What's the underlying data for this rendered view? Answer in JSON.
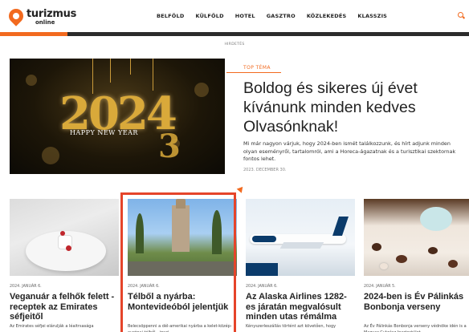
{
  "brand": {
    "name": "turizmus",
    "sub": "online",
    "accent": "#f26a1f"
  },
  "nav": {
    "items": [
      "BELFÖLD",
      "KÜLFÖLD",
      "HOTEL",
      "GASZTRO",
      "KÖZLEKEDÉS",
      "KLASSZIS"
    ]
  },
  "ad_label": "HIRDETÉS",
  "hero": {
    "image_text": "HAPPY NEW YEAR",
    "year": "2024",
    "tag": "TOP TÉMA",
    "title": "Boldog és sikeres új évet kívánunk minden kedves Olvasónknak!",
    "description": "Mi már nagyon várjuk, hogy 2024-ben ismét találkozzunk, és hírt adjunk minden olyan eseményről, tartalomról, ami a Horeca-ágazatnak és a turisztikai szektornak fontos lehet.",
    "date": "2023. DECEMBER 30."
  },
  "cards": [
    {
      "date": "2024. JANUÁR 6.",
      "title": "Veganuár a felhők felett - receptek az Emirates séfjeitől",
      "desc": "Az Emirates séfjei elárulják a léaitrsasága"
    },
    {
      "date": "2024. JANUÁR 6.",
      "title": "Télből a nyárba: Montevideóból jelentjük",
      "desc": "Belecsöppenni a dél-amerikai nyárba a kelet-közép-európai télből - igazi"
    },
    {
      "date": "2024. JANUÁR 6.",
      "title": "Az Alaska Airlines 1282-es járatán megvalósult minden utas rémálma",
      "desc": "Kényszerleszállás történt azt követően, hogy"
    },
    {
      "date": "2024. JANUÁR 5.",
      "title": "2024-ben is Év Pálinkás Bonbonja verseny",
      "desc": "Az Év Pálinkás Bonbonja verseny védnöke idén is a Magyar Cukrász Ipartestület."
    }
  ]
}
